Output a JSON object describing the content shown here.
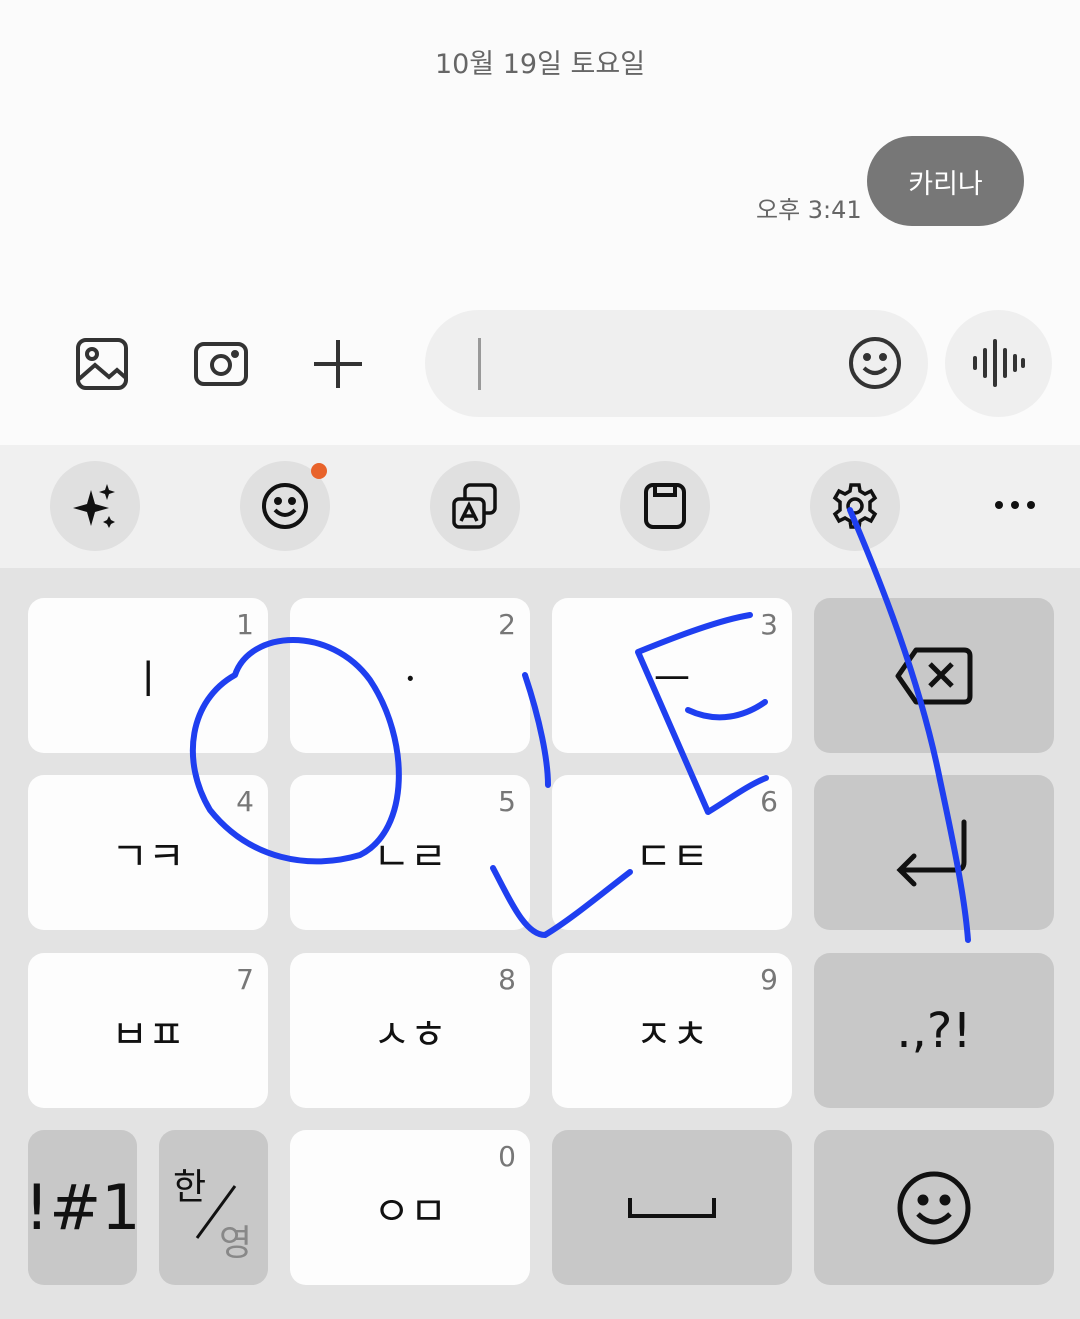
{
  "chat": {
    "date": "10월 19일 토요일",
    "messages": [
      {
        "text": "카리나",
        "time": "오후 3:41"
      }
    ]
  },
  "composer": {
    "value": "",
    "icons": [
      "gallery-icon",
      "camera-icon",
      "plus-icon",
      "emoji-icon",
      "voice-icon"
    ]
  },
  "toolbar": {
    "icons": [
      "ai-sparkle-icon",
      "emoji-icon",
      "translate-icon",
      "clipboard-icon",
      "settings-icon",
      "more-icon"
    ],
    "notification_dot_color": "#e8632b"
  },
  "keyboard": {
    "keys": [
      {
        "label": "ㅣ",
        "num": "1"
      },
      {
        "label": "ㆍ",
        "num": "2"
      },
      {
        "label": "ㅡ",
        "num": "3"
      },
      {
        "label": "ㄱㅋ",
        "num": "4"
      },
      {
        "label": "ㄴㄹ",
        "num": "5"
      },
      {
        "label": "ㄷㅌ",
        "num": "6"
      },
      {
        "label": "ㅂㅍ",
        "num": "7"
      },
      {
        "label": "ㅅㅎ",
        "num": "8"
      },
      {
        "label": "ㅈㅊ",
        "num": "9"
      },
      {
        "label": "ㅇㅁ",
        "num": "0"
      }
    ],
    "punct": ".,?!",
    "symbols": "!#1",
    "lang_primary": "한",
    "lang_secondary": "영"
  },
  "handwriting_color": "#1f3ff0"
}
